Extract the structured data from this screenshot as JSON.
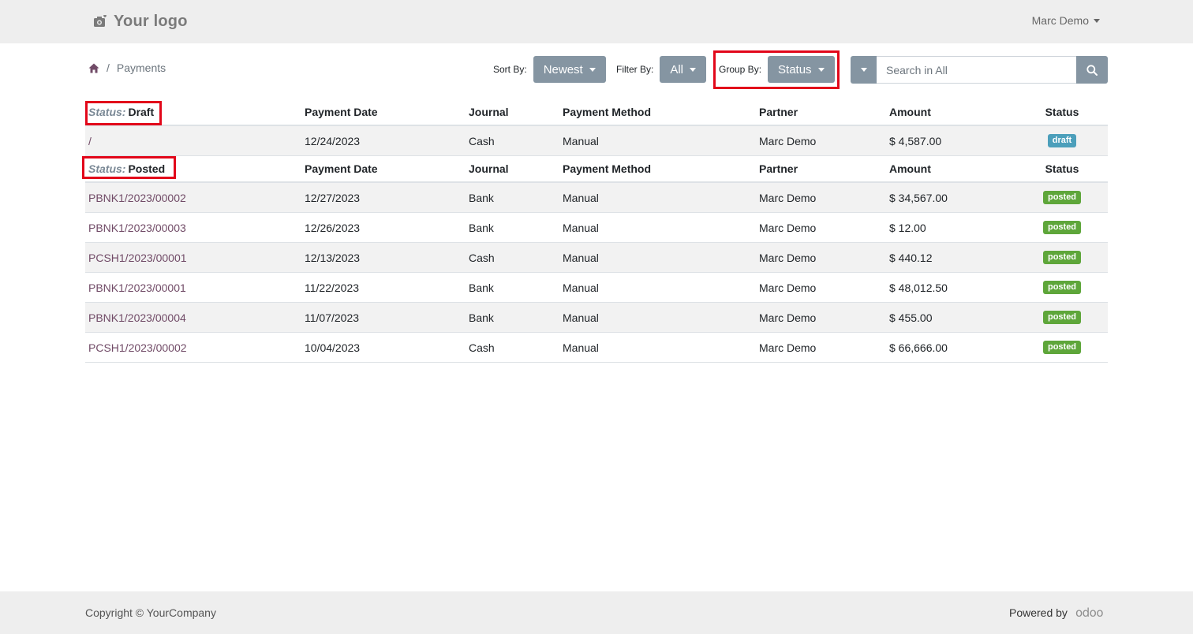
{
  "header": {
    "logo_text": "Your logo",
    "user_name": "Marc Demo"
  },
  "breadcrumb": {
    "current": "Payments"
  },
  "toolbar": {
    "sort_label": "Sort By:",
    "sort_value": "Newest",
    "filter_label": "Filter By:",
    "filter_value": "All",
    "group_label": "Group By:",
    "group_value": "Status",
    "search_placeholder": "Search in All"
  },
  "table": {
    "columns": [
      "Payment Date",
      "Journal",
      "Payment Method",
      "Partner",
      "Amount",
      "Status"
    ],
    "groups": [
      {
        "key": "Status:",
        "value": "Draft",
        "rows": [
          [
            "/",
            "12/24/2023",
            "Cash",
            "Manual",
            "Marc Demo",
            "$ 4,587.00",
            "draft"
          ]
        ]
      },
      {
        "key": "Status:",
        "value": "Posted",
        "rows": [
          [
            "PBNK1/2023/00002",
            "12/27/2023",
            "Bank",
            "Manual",
            "Marc Demo",
            "$ 34,567.00",
            "posted"
          ],
          [
            "PBNK1/2023/00003",
            "12/26/2023",
            "Bank",
            "Manual",
            "Marc Demo",
            "$ 12.00",
            "posted"
          ],
          [
            "PCSH1/2023/00001",
            "12/13/2023",
            "Cash",
            "Manual",
            "Marc Demo",
            "$ 440.12",
            "posted"
          ],
          [
            "PBNK1/2023/00001",
            "11/22/2023",
            "Bank",
            "Manual",
            "Marc Demo",
            "$ 48,012.50",
            "posted"
          ],
          [
            "PBNK1/2023/00004",
            "11/07/2023",
            "Bank",
            "Manual",
            "Marc Demo",
            "$ 455.00",
            "posted"
          ],
          [
            "PCSH1/2023/00002",
            "10/04/2023",
            "Cash",
            "Manual",
            "Marc Demo",
            "$ 66,666.00",
            "posted"
          ]
        ]
      }
    ]
  },
  "footer": {
    "copyright": "Copyright © YourCompany",
    "powered_by": "Powered by",
    "brand": "odoo"
  },
  "colors": {
    "highlight": "#e2071a",
    "button": "#8595a2",
    "link": "#714b67",
    "badge_draft": "#4c9fbb",
    "badge_posted": "#5ea63a"
  }
}
